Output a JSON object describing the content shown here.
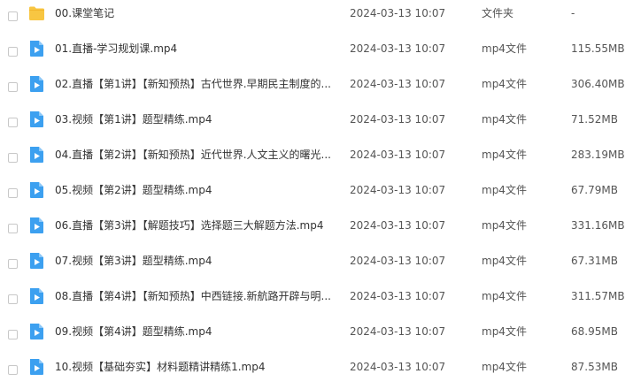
{
  "colors": {
    "folder": "#f8c642",
    "folder_tab": "#f2b52c",
    "video": "#3ca0f0",
    "text": "#333333"
  },
  "files": [
    {
      "name": "00.课堂笔记",
      "date": "2024-03-13 10:07",
      "type": "文件夹",
      "size": "-",
      "icon": "folder-icon"
    },
    {
      "name": "01.直播-学习规划课.mp4",
      "date": "2024-03-13 10:07",
      "type": "mp4文件",
      "size": "115.55MB",
      "icon": "video-icon"
    },
    {
      "name": "02.直播【第1讲】【新知预热】古代世界.早期民主制度的...",
      "date": "2024-03-13 10:07",
      "type": "mp4文件",
      "size": "306.40MB",
      "icon": "video-icon"
    },
    {
      "name": "03.视频【第1讲】题型精练.mp4",
      "date": "2024-03-13 10:07",
      "type": "mp4文件",
      "size": "71.52MB",
      "icon": "video-icon"
    },
    {
      "name": "04.直播【第2讲】【新知预热】近代世界.人文主义的曙光...",
      "date": "2024-03-13 10:07",
      "type": "mp4文件",
      "size": "283.19MB",
      "icon": "video-icon"
    },
    {
      "name": "05.视频【第2讲】题型精练.mp4",
      "date": "2024-03-13 10:07",
      "type": "mp4文件",
      "size": "67.79MB",
      "icon": "video-icon"
    },
    {
      "name": "06.直播【第3讲】【解题技巧】选择题三大解题方法.mp4",
      "date": "2024-03-13 10:07",
      "type": "mp4文件",
      "size": "331.16MB",
      "icon": "video-icon"
    },
    {
      "name": "07.视频【第3讲】题型精练.mp4",
      "date": "2024-03-13 10:07",
      "type": "mp4文件",
      "size": "67.31MB",
      "icon": "video-icon"
    },
    {
      "name": "08.直播【第4讲】【新知预热】中西链接.新航路开辟与明...",
      "date": "2024-03-13 10:07",
      "type": "mp4文件",
      "size": "311.57MB",
      "icon": "video-icon"
    },
    {
      "name": "09.视频【第4讲】题型精练.mp4",
      "date": "2024-03-13 10:07",
      "type": "mp4文件",
      "size": "68.95MB",
      "icon": "video-icon"
    },
    {
      "name": "10.视频【基础夯实】材料题精讲精练1.mp4",
      "date": "2024-03-13 10:07",
      "type": "mp4文件",
      "size": "87.53MB",
      "icon": "video-icon"
    }
  ]
}
